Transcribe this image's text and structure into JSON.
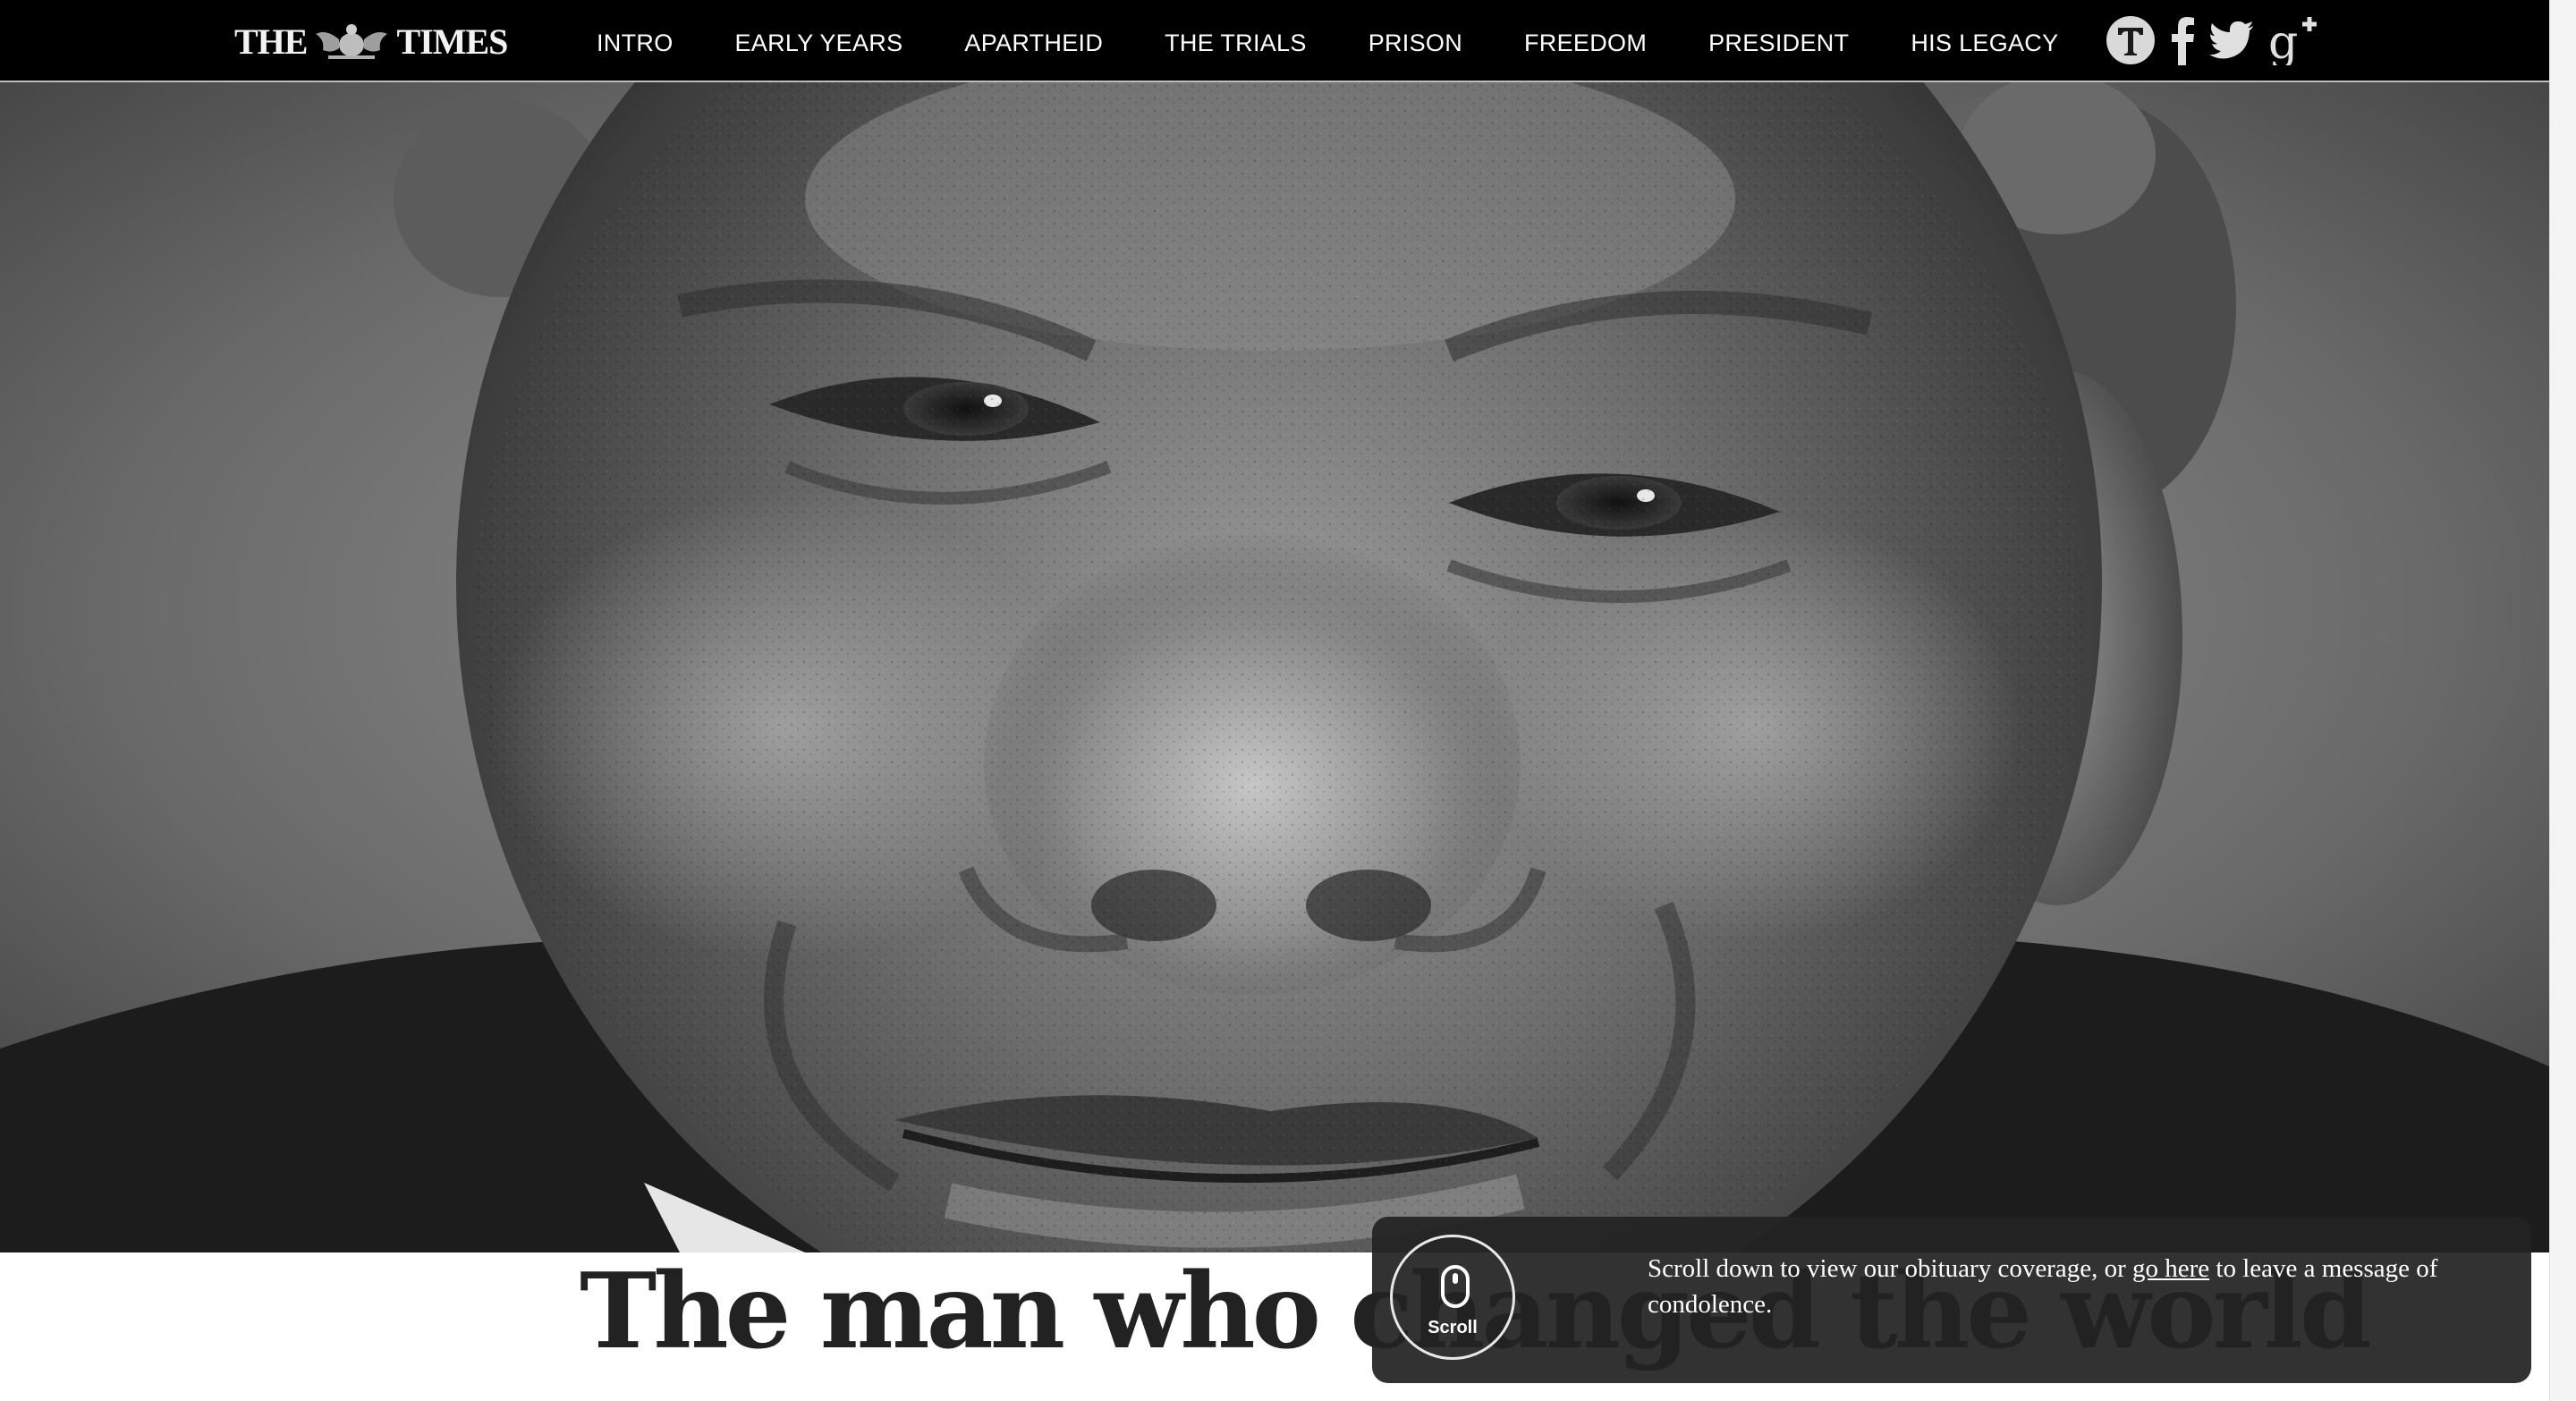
{
  "brand": {
    "logo_left": "THE",
    "logo_right": "TIMES",
    "logo_crest_icon": "royal-crest-icon"
  },
  "nav": {
    "items": [
      {
        "label": "INTRO"
      },
      {
        "label": "EARLY YEARS"
      },
      {
        "label": "APARTHEID"
      },
      {
        "label": "THE TRIALS"
      },
      {
        "label": "PRISON"
      },
      {
        "label": "FREEDOM"
      },
      {
        "label": "PRESIDENT"
      },
      {
        "label": "HIS LEGACY"
      }
    ]
  },
  "social": {
    "icons": [
      "times-t-icon",
      "facebook-icon",
      "twitter-icon",
      "google-plus-icon"
    ]
  },
  "hero": {
    "image_icon": "portrait-photo-icon"
  },
  "headline": "The man who changed the world",
  "notice": {
    "scroll_label": "Scroll",
    "scroll_icon": "mouse-scroll-icon",
    "text_before": "Scroll down to view our obituary coverage, or ",
    "link_text": "go here",
    "text_after": " to leave a message of condolence."
  },
  "colors": {
    "topbar_background": "#000000",
    "nav_text": "#ffffff",
    "headline_text": "#222222",
    "notice_background": "#222222"
  }
}
